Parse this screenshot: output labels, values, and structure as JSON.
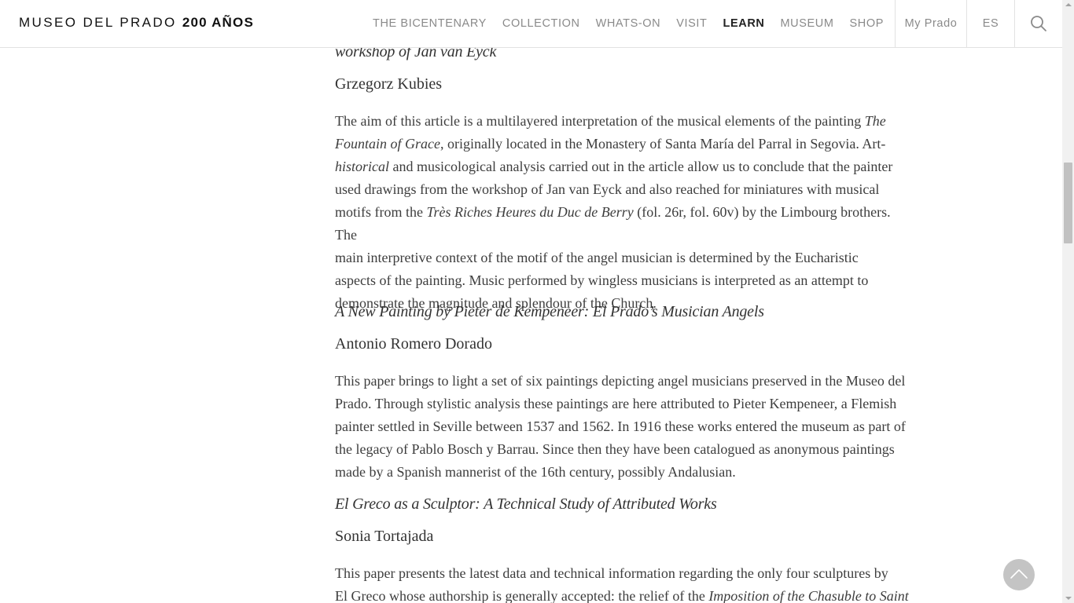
{
  "header": {
    "logo": {
      "regular": "MUSEO DEL PRADO",
      "bold": "200 AÑOS"
    },
    "nav": [
      {
        "label": "THE BICENTENARY"
      },
      {
        "label": "COLLECTION"
      },
      {
        "label": "WHATS-ON"
      },
      {
        "label": "VISIT"
      },
      {
        "label": "LEARN",
        "active": true
      },
      {
        "label": "MUSEUM"
      },
      {
        "label": "SHOP"
      }
    ],
    "account_label": "My Prado",
    "language_label": "ES",
    "search_icon": "search-icon"
  },
  "articles": [
    {
      "title_tail": "workshop of Jan van Eyck",
      "author": "Grzegorz Kubies",
      "abstract_lines": [
        [
          {
            "t": "The aim of this article is a multilayered interpretation of the musical elements of the painting "
          },
          {
            "t": "The",
            "i": true
          }
        ],
        [
          {
            "t": "Fountain of Grace",
            "i": true
          },
          {
            "t": ", originally located in the Monastery of Santa María del Parral in Segovia. Art-"
          }
        ],
        [
          {
            "t": "historical",
            "i": true
          },
          {
            "t": " and musicological analysis carried out in the article allow us to conclude that the painter"
          }
        ],
        [
          {
            "t": "used drawings from the workshop of Jan van Eyck and also reached for miniatures with musical"
          }
        ],
        [
          {
            "t": "motifs from the "
          },
          {
            "t": "Très Riches Heures du Duc de Berry",
            "i": true
          },
          {
            "t": " (fol. 26r, fol. 60v) by the Limbourg brothers. The"
          }
        ],
        [
          {
            "t": "main interpretive context of the motif of the angel musician is determined by the Eucharistic"
          }
        ],
        [
          {
            "t": "aspects of the painting. Music performed by wingless musicians is interpreted as an attempt to"
          }
        ],
        [
          {
            "t": "demonstrate the magnitude and splendour of the Church."
          }
        ]
      ]
    },
    {
      "title": "A New Painting by Pieter de Kempeneer: El Prado’s Musician Angels",
      "author": "Antonio Romero Dorado",
      "abstract_lines": [
        [
          {
            "t": "This paper brings to light a set of six paintings depicting angel musicians preserved in the Museo del"
          }
        ],
        [
          {
            "t": "Prado. Through stylistic analysis these paintings are here attributed to Pieter Kempeneer, a Flemish"
          }
        ],
        [
          {
            "t": "painter settled in Seville between 1537 and 1562. In 1916 these works entered the museum as part of"
          }
        ],
        [
          {
            "t": "the legacy of Pablo Bosch y Barrau. Since then they have been catalogued as anonymous paintings"
          }
        ],
        [
          {
            "t": "made by a Spanish mannerist of the 16th century, possibly Andalusian."
          }
        ]
      ]
    },
    {
      "title": "El Greco as a Sculptor: A Technical Study of Attributed Works",
      "author": "Sonia Tortajada",
      "abstract_lines": [
        [
          {
            "t": "This paper presents the latest data and technical information regarding the only four sculptures by"
          }
        ],
        [
          {
            "t": "El Greco whose authorship is generally accepted: the relief of the "
          },
          {
            "t": "Imposition of the Chasuble to Saint",
            "i": true
          }
        ]
      ]
    }
  ],
  "back_to_top_icon": "chevron-up-icon"
}
